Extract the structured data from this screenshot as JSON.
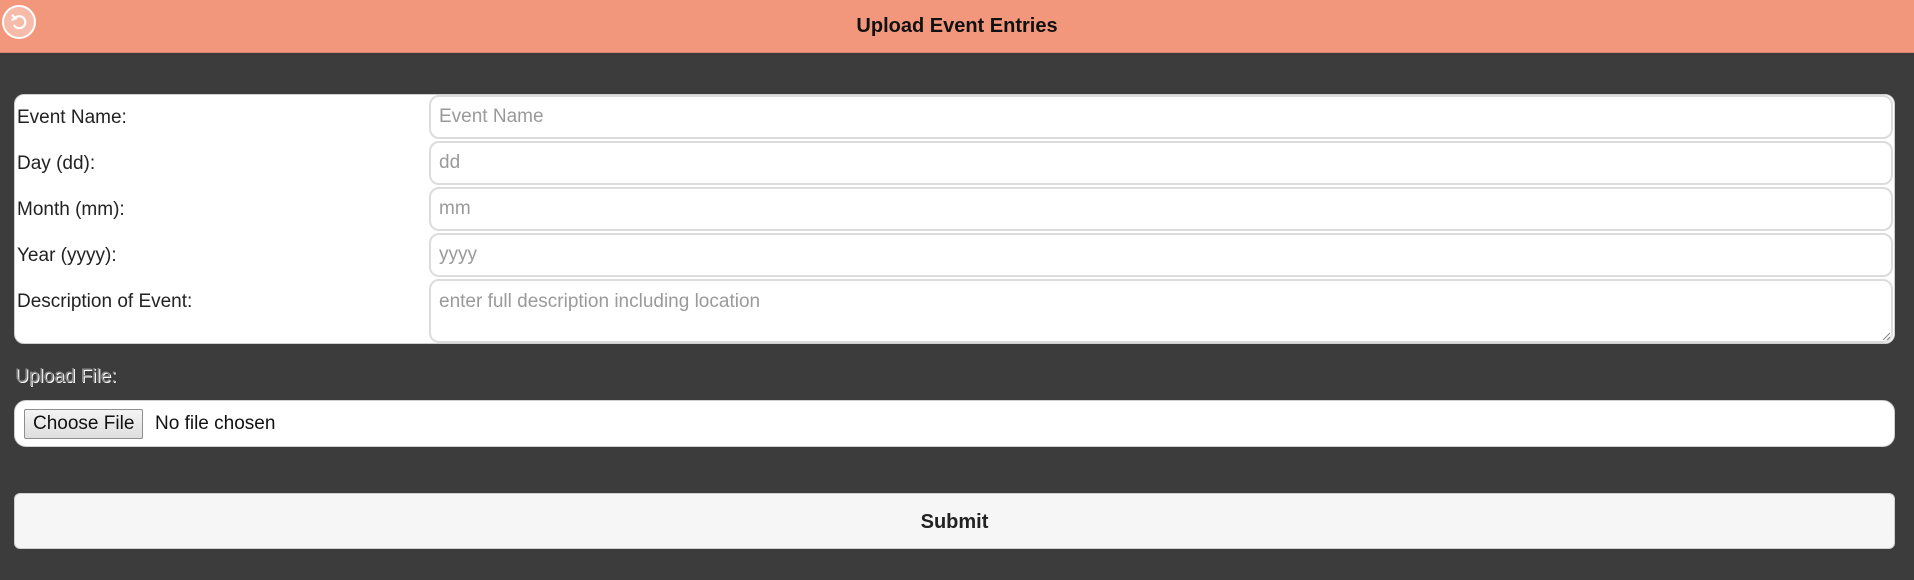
{
  "header": {
    "title": "Upload Event Entries",
    "back_icon": "back-arrow-icon",
    "background_color": "#f2977c"
  },
  "form": {
    "fields": [
      {
        "label": "Event Name:",
        "placeholder": "Event Name",
        "value": ""
      },
      {
        "label": "Day (dd):",
        "placeholder": "dd",
        "value": ""
      },
      {
        "label": "Month (mm):",
        "placeholder": "mm",
        "value": ""
      },
      {
        "label": "Year (yyyy):",
        "placeholder": "yyyy",
        "value": ""
      },
      {
        "label": "Description of Event:",
        "placeholder": "enter full description including location",
        "value": ""
      }
    ]
  },
  "upload": {
    "label": "Upload File:",
    "button_label": "Choose File",
    "status": "No file chosen"
  },
  "submit": {
    "label": "Submit"
  }
}
